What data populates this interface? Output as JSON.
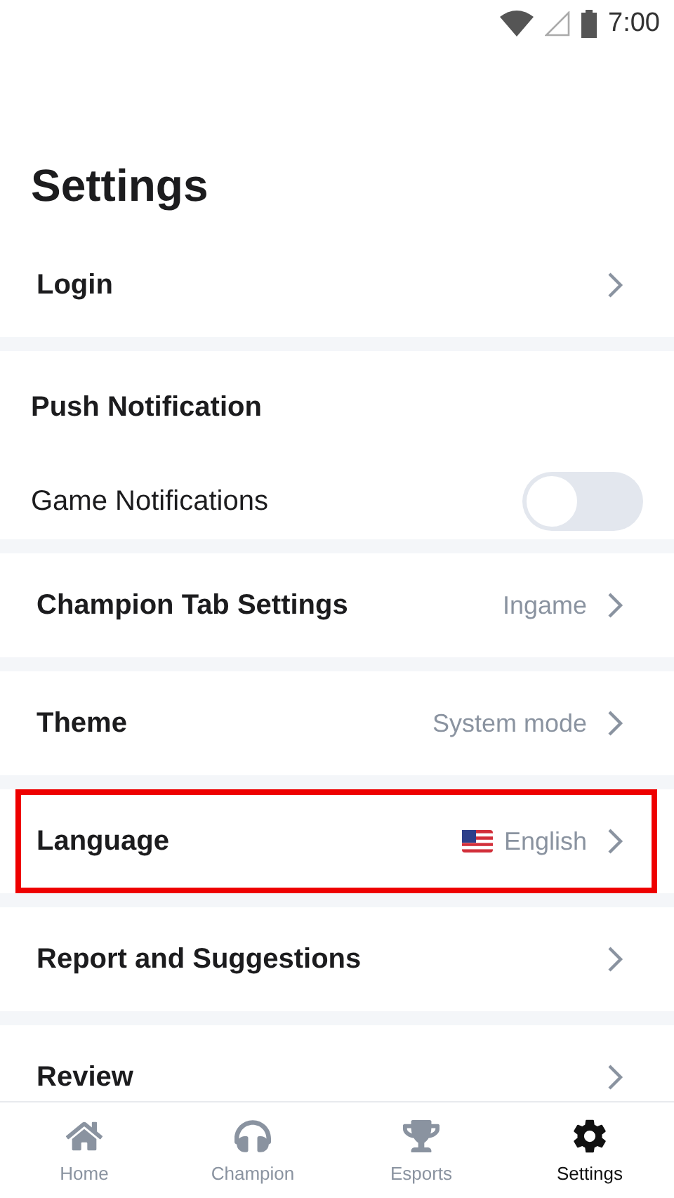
{
  "status_bar": {
    "time": "7:00"
  },
  "title": "Settings",
  "groups": [
    {
      "items": [
        {
          "kind": "link",
          "label": "Login",
          "highlighted": false
        }
      ]
    },
    {
      "items": [
        {
          "kind": "heading",
          "label": "Push Notification"
        },
        {
          "kind": "toggle",
          "label": "Game Notifications",
          "on": false
        }
      ]
    },
    {
      "items": [
        {
          "kind": "link",
          "label": "Champion Tab Settings",
          "value": "Ingame",
          "highlighted": false
        }
      ]
    },
    {
      "items": [
        {
          "kind": "link",
          "label": "Theme",
          "value": "System mode",
          "highlighted": false
        }
      ]
    },
    {
      "items": [
        {
          "kind": "link",
          "label": "Language",
          "value": "English",
          "flag": true,
          "highlighted": true
        }
      ]
    },
    {
      "items": [
        {
          "kind": "link",
          "label": "Report and Suggestions",
          "highlighted": false
        }
      ]
    },
    {
      "items": [
        {
          "kind": "link",
          "label": "Review",
          "highlighted": false
        }
      ]
    }
  ],
  "nav": [
    {
      "kind": "home",
      "label": "Home",
      "selected": false
    },
    {
      "kind": "champion",
      "label": "Champion",
      "selected": false
    },
    {
      "kind": "esports",
      "label": "Esports",
      "selected": false
    },
    {
      "kind": "settings",
      "label": "Settings",
      "selected": true
    }
  ]
}
